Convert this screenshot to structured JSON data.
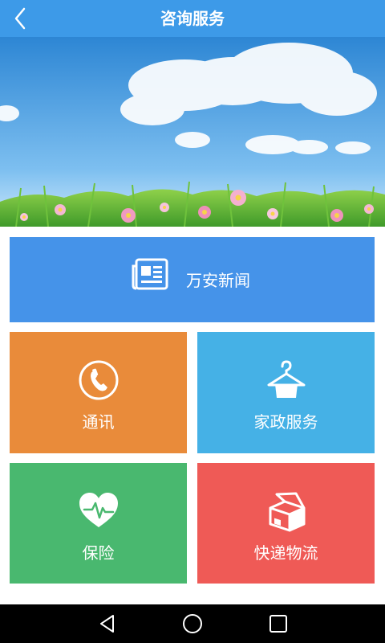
{
  "header": {
    "title": "咨询服务",
    "back_icon": "chevron-left-icon"
  },
  "hero": {
    "image": "sky-clouds-flower-meadow"
  },
  "tiles": {
    "news": {
      "label": "万安新闻",
      "icon": "newspaper-icon",
      "color": "#4593e9"
    },
    "communication": {
      "label": "通讯",
      "icon": "phone-icon",
      "color": "#e98b3a"
    },
    "housekeeping": {
      "label": "家政服务",
      "icon": "clothes-hanger-icon",
      "color": "#45b1e6"
    },
    "insurance": {
      "label": "保险",
      "icon": "heart-pulse-icon",
      "color": "#49b86f"
    },
    "express": {
      "label": "快递物流",
      "icon": "package-box-icon",
      "color": "#ef5a56"
    }
  },
  "system_nav": {
    "back": "triangle-back-icon",
    "home": "circle-home-icon",
    "recents": "square-recents-icon"
  }
}
